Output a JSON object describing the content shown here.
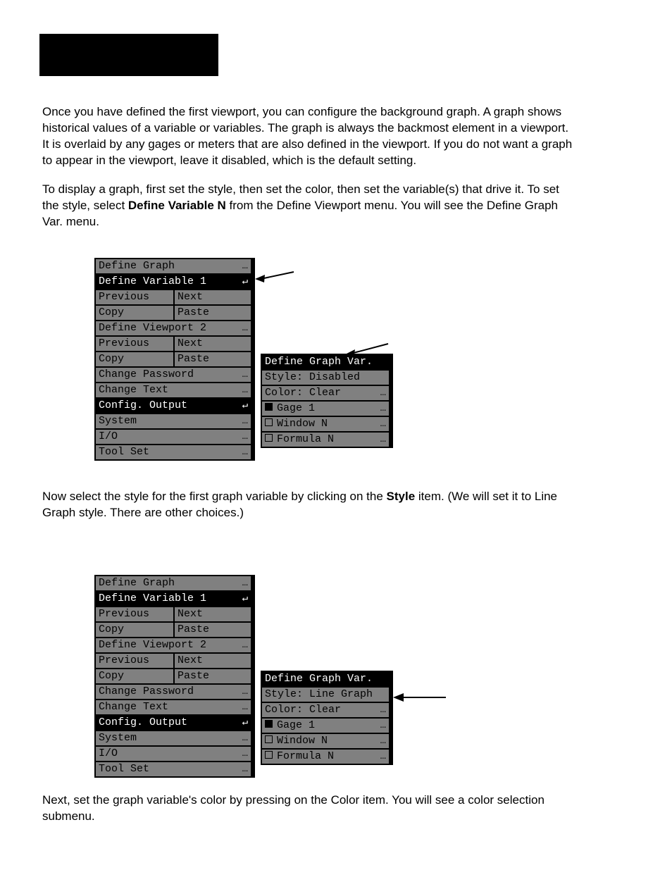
{
  "paragraphs": {
    "a1": "Once you have defined the first viewport, you can configure the background graph. A graph shows historical values of a variable or variables. The graph is always the backmost element in a viewport. It is overlaid by any gages or meters that are also defined in the viewport. If you do not want a graph to appear in the viewport, leave it disabled, which is the default setting.",
    "a2": "To display a graph, first set the style, then set the color, then set the variable(s) that drive it. To set the style, select ",
    "a2b": "Define Variable N",
    "a2c": " from the Define Viewport menu. You will see the Define Graph Var. menu.",
    "b1": "Now select the style for the first graph variable by clicking on the ",
    "b1b": "Style",
    "b1c": " item. (We will set it to Line Graph style. There are other choices.)",
    "c1": "Next, set the graph variable's color by pressing on the Color item. You will see a color selection submenu."
  },
  "menu_main": {
    "define_graph": "Define Graph",
    "define_variable": "Define Variable 1",
    "previous": "Previous",
    "next": "Next",
    "copy": "Copy",
    "paste": "Paste",
    "define_viewport": "Define Viewport 2",
    "change_password": "Change Password",
    "change_text": "Change Text",
    "config_output": "Config. Output",
    "system": "System",
    "io": "I/O",
    "tool_set": "Tool Set",
    "dots": "…",
    "enter": "↵"
  },
  "menu_subA": {
    "title": "Define Graph Var.",
    "style": "Style: Disabled",
    "color": "Color: Clear",
    "gage": "Gage 1",
    "window": "Window N",
    "formula": "Formula N",
    "dots": "…"
  },
  "menu_subB": {
    "title": "Define Graph Var.",
    "style": "Style: Line Graph",
    "color": "Color: Clear",
    "gage": "Gage 1",
    "window": "Window N",
    "formula": "Formula N",
    "dots": "…"
  }
}
